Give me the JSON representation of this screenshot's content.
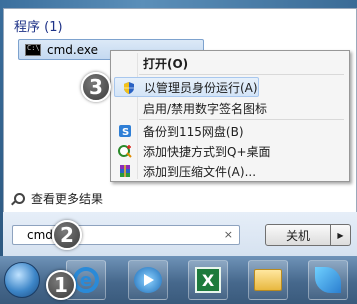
{
  "start_menu": {
    "section_title": "程序 (1)",
    "result_item": "cmd.exe",
    "more_results": "查看更多结果",
    "search_value": "cmd",
    "clear_symbol": "×",
    "shutdown_label": "关机",
    "shutdown_arrow": "▶"
  },
  "context_menu": {
    "items": [
      {
        "label": "打开(O)",
        "icon": "none"
      },
      {
        "label": "以管理员身份运行(A)",
        "icon": "uac-shield-icon"
      },
      {
        "label": "启用/禁用数字签名图标",
        "icon": "none"
      },
      {
        "label": "备份到115网盘(B)",
        "icon": "115-cloud-icon"
      },
      {
        "label": "添加快捷方式到Q+桌面",
        "icon": "qplus-icon"
      },
      {
        "label": "添加到压缩文件(A)...",
        "icon": "winrar-icon"
      }
    ]
  },
  "badges": {
    "one": "1",
    "two": "2",
    "three": "3"
  },
  "taskbar": {
    "items": [
      "start-orb",
      "internet-explorer-icon",
      "media-player-icon",
      "excel-icon",
      "folder-icon",
      "feather-app-icon"
    ]
  },
  "colors": {
    "title_blue": "#1e3287",
    "highlight": "#d3e4f7",
    "taskbar": "#46688c"
  }
}
